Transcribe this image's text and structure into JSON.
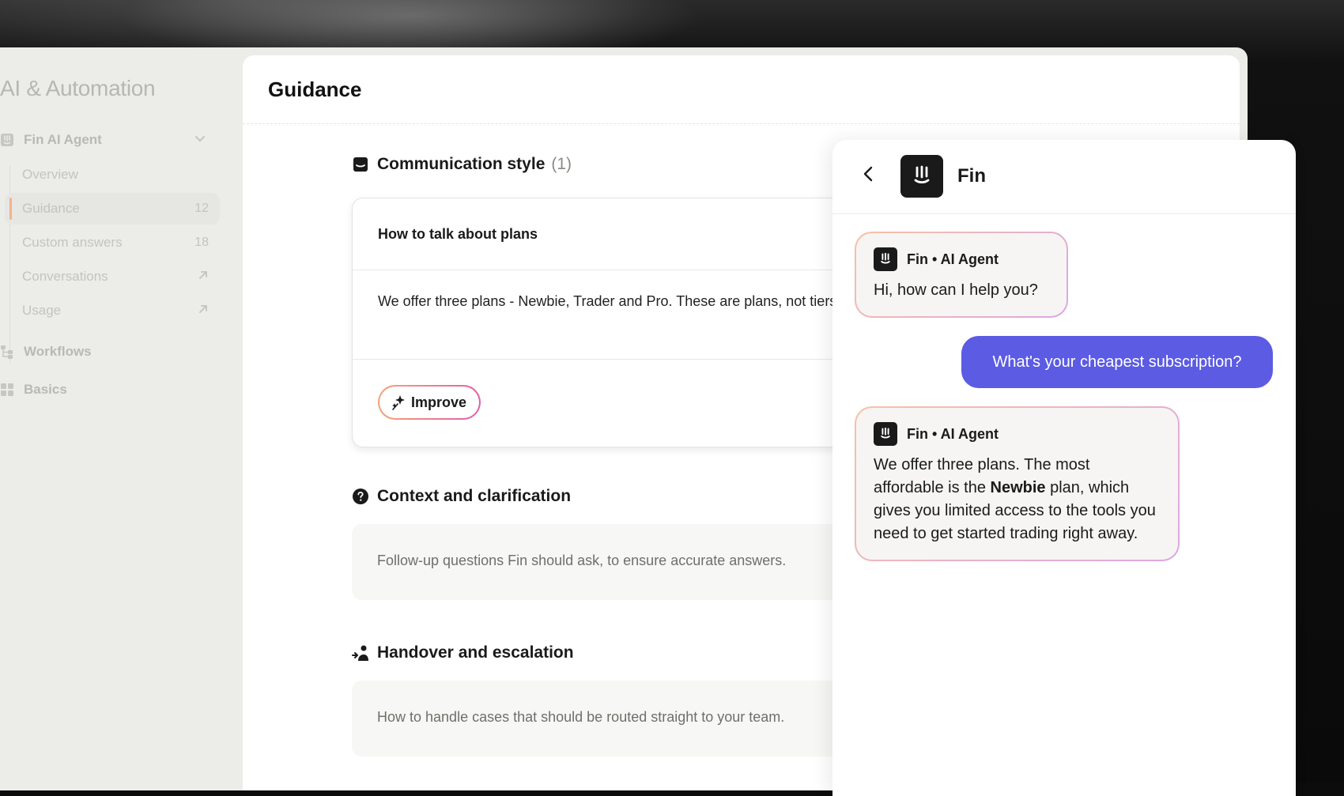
{
  "sidebar": {
    "title": "AI & Automation",
    "fin_agent_label": "Fin AI Agent",
    "items": [
      {
        "label": "Overview",
        "count": ""
      },
      {
        "label": "Guidance",
        "count": "12"
      },
      {
        "label": "Custom answers",
        "count": "18"
      },
      {
        "label": "Conversations",
        "count": ""
      },
      {
        "label": "Usage",
        "count": ""
      }
    ],
    "workflows_label": "Workflows",
    "basics_label": "Basics"
  },
  "main": {
    "title": "Guidance",
    "sections": {
      "communication": {
        "title": "Communication style",
        "count": "(1)"
      },
      "context": {
        "title": "Context and clarification",
        "placeholder": "Follow-up questions Fin should ask, to ensure accurate answers."
      },
      "handover": {
        "title": "Handover and escalation",
        "placeholder": "How to handle cases that should be routed straight to your team."
      }
    },
    "card": {
      "title": "How to talk about plans",
      "body": "We offer three plans - Newbie, Trader and Pro. These are plans, not tiers.",
      "improve_label": "Improve"
    }
  },
  "chat": {
    "title": "Fin",
    "sender": "Fin • AI Agent",
    "greeting": "Hi, how can I help you?",
    "user_message": "What's your cheapest subscription?",
    "reply_before": "We offer three plans. The most affordable is the ",
    "reply_bold": "Newbie",
    "reply_after": " plan, which gives you limited access to the tools you need to get started trading right away."
  },
  "colors": {
    "accent": "#5b5be3",
    "active_bar": "#f2b48f"
  }
}
